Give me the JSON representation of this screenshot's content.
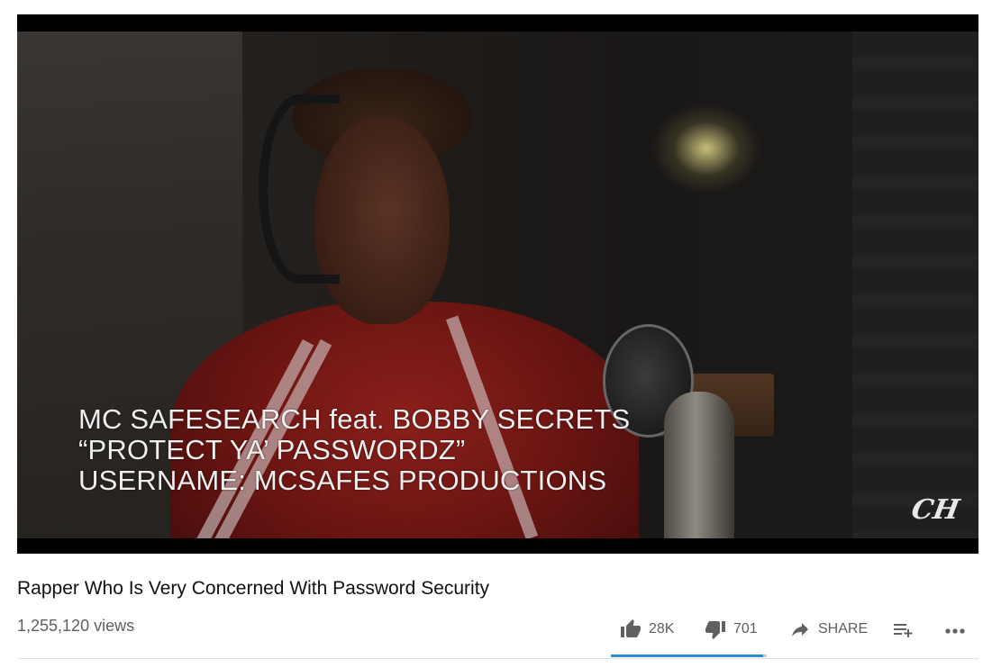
{
  "video": {
    "caption_lines": [
      "MC SAFESEARCH feat. BOBBY SECRETS",
      "“PROTECT YA’ PASSWORDZ”",
      "USERNAME: MCSAFES PRODUCTIONS"
    ],
    "watermark": "CH"
  },
  "info": {
    "title": "Rapper Who Is Very Concerned With Password Security",
    "views": "1,255,120 views"
  },
  "actions": {
    "like": {
      "icon": "thumbs-up-icon",
      "count": "28K"
    },
    "dislike": {
      "icon": "thumbs-down-icon",
      "count": "701"
    },
    "share": {
      "icon": "share-arrow-icon",
      "label": "SHARE"
    },
    "save": {
      "icon": "add-to-playlist-icon"
    },
    "more": {
      "icon": "more-horizontal-icon"
    }
  },
  "sentiment": {
    "like_fraction": 0.976,
    "fill_color": "#2f8ad3",
    "track_color": "#cccccc"
  }
}
